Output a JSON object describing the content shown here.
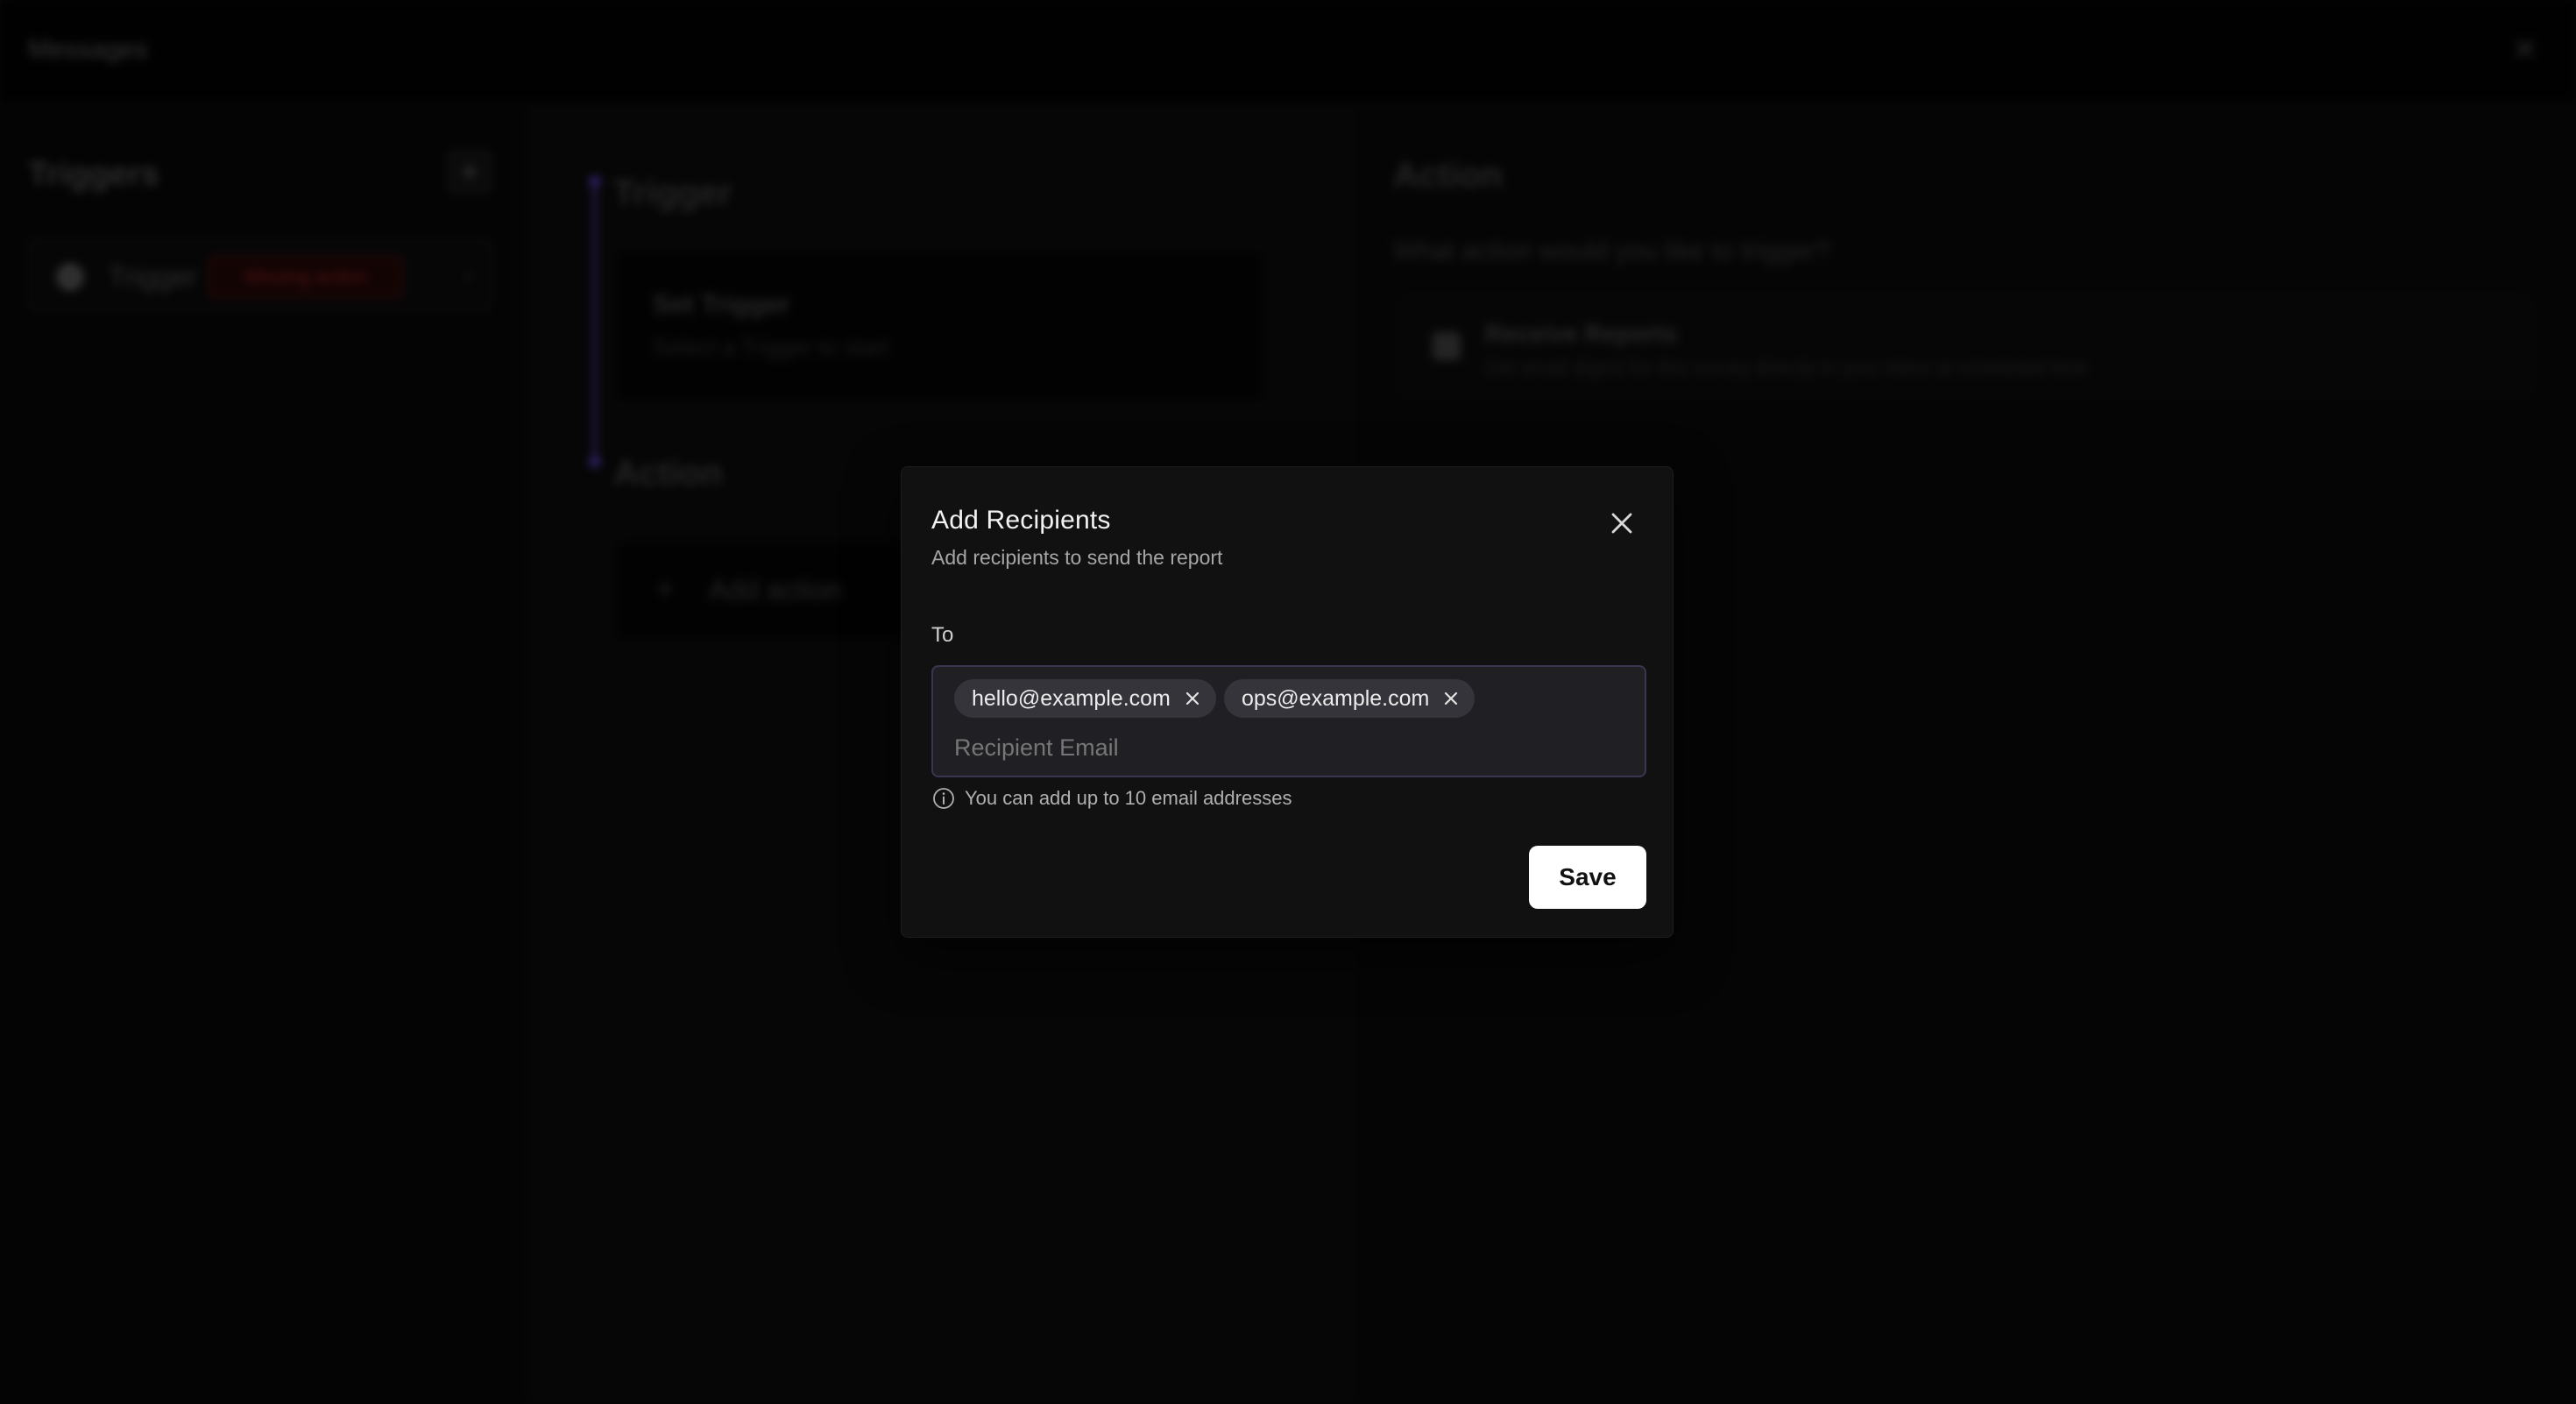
{
  "app": {
    "title": "Messages"
  },
  "left_panel": {
    "heading": "Triggers",
    "add_label": "+",
    "trigger_item": {
      "label": "Trigger",
      "badge": "Missing action",
      "chevron": "›"
    }
  },
  "middle_panel": {
    "trigger_heading": "Trigger",
    "set_trigger_title": "Set Trigger",
    "set_trigger_subtitle": "Select a Trigger to start",
    "action_heading": "Action",
    "add_action_label": "Add action",
    "add_action_icon": "+"
  },
  "right_panel": {
    "heading": "Action",
    "question": "What action would you like to trigger?",
    "option_title": "Receive Reports",
    "option_subtitle": "Get email digest for this survey directly in your inbox at scheduled time"
  },
  "modal": {
    "title": "Add Recipients",
    "subtitle": "Add recipients to send the report",
    "to_label": "To",
    "recipients": [
      "hello@example.com",
      "ops@example.com"
    ],
    "input_placeholder": "Recipient Email",
    "input_value": "",
    "hint": "You can add up to 10 email addresses",
    "save_label": "Save"
  },
  "icons": {
    "close": "close-icon",
    "chip_remove": "x-icon",
    "info": "info-icon"
  },
  "colors": {
    "modal_bg": "#111111",
    "input_bg": "#202024",
    "input_border": "#3a3550",
    "chip_bg": "#34343a",
    "save_bg": "#ffffff",
    "badge_red": "#8a2020",
    "timeline_purple": "#4b35a0"
  }
}
